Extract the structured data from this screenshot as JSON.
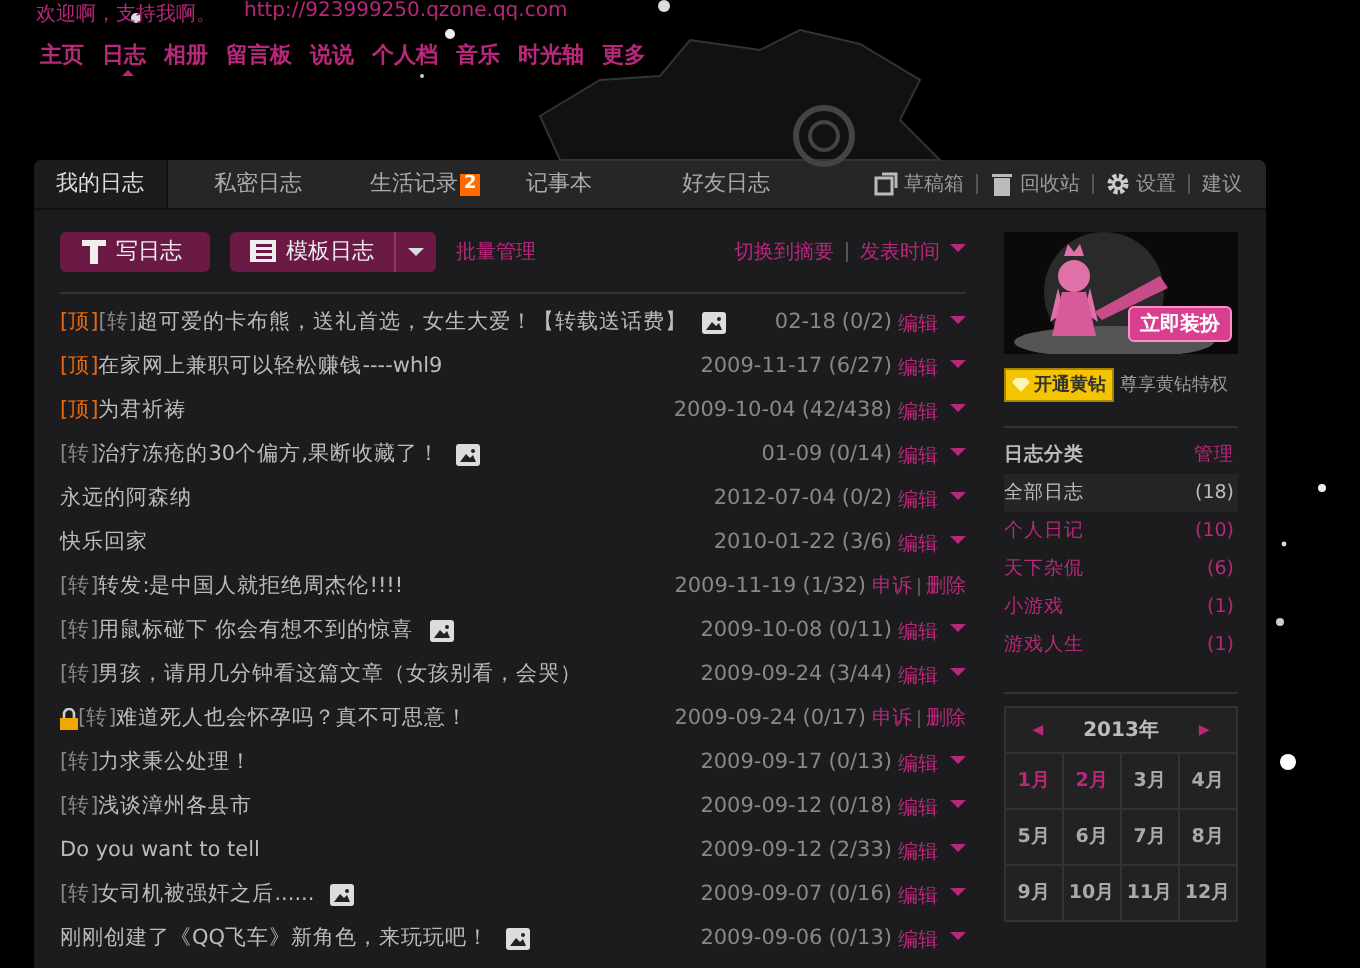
{
  "header": {
    "greeting": "欢迎啊，支持我啊。",
    "url": "http://923999250.qzone.qq.com",
    "nav": [
      {
        "label": "主页",
        "selected": false
      },
      {
        "label": "日志",
        "selected": true
      },
      {
        "label": "相册",
        "selected": false
      },
      {
        "label": "留言板",
        "selected": false
      },
      {
        "label": "说说",
        "selected": false
      },
      {
        "label": "个人档",
        "selected": false
      },
      {
        "label": "音乐",
        "selected": false
      },
      {
        "label": "时光轴",
        "selected": false
      },
      {
        "label": "更多",
        "selected": false
      }
    ]
  },
  "tabs": [
    {
      "label": "我的日志",
      "selected": true
    },
    {
      "label": "私密日志",
      "selected": false
    },
    {
      "label": "生活记录",
      "selected": false,
      "badge": "2"
    },
    {
      "label": "记事本",
      "selected": false
    },
    {
      "label": "好友日志",
      "selected": false
    }
  ],
  "tools": [
    {
      "kind": "drafts",
      "label": "草稿箱"
    },
    {
      "kind": "trash",
      "label": "回收站"
    },
    {
      "kind": "settings",
      "label": "设置"
    },
    {
      "kind": "plain",
      "label": "建议"
    }
  ],
  "toolbar": {
    "write_button": "写日志",
    "template_button": "模板日志",
    "batch": "批量管理",
    "switch": "切换到摘要",
    "sort": "发表时间"
  },
  "posts": [
    {
      "top": "[顶]",
      "tag": "[转]",
      "locked": false,
      "title": "超可爱的卡布熊，送礼首选，女生大爱！【转载送话费】",
      "image": true,
      "date": "02-18",
      "counts": "(0/2)",
      "actions": {
        "kind": "edit",
        "labels": [
          "编辑"
        ]
      }
    },
    {
      "top": "[顶]",
      "locked": false,
      "title": "在家网上兼职可以轻松赚钱----whl9",
      "image": false,
      "date": "2009-11-17",
      "counts": "(6/27)",
      "actions": {
        "kind": "edit",
        "labels": [
          "编辑"
        ]
      }
    },
    {
      "top": "[顶]",
      "locked": false,
      "title": "为君祈祷",
      "image": false,
      "date": "2009-10-04",
      "counts": "(42/438)",
      "actions": {
        "kind": "edit",
        "labels": [
          "编辑"
        ]
      }
    },
    {
      "tag": "[转]",
      "locked": false,
      "title": "治疗冻疮的30个偏方,果断收藏了！",
      "image": true,
      "date": "01-09",
      "counts": "(0/14)",
      "actions": {
        "kind": "edit",
        "labels": [
          "编辑"
        ]
      }
    },
    {
      "locked": false,
      "title": "永远的阿森纳",
      "image": false,
      "date": "2012-07-04",
      "counts": "(0/2)",
      "actions": {
        "kind": "edit",
        "labels": [
          "编辑"
        ]
      }
    },
    {
      "locked": false,
      "title": "快乐回家",
      "image": false,
      "date": "2010-01-22",
      "counts": "(3/6)",
      "actions": {
        "kind": "edit",
        "labels": [
          "编辑"
        ]
      }
    },
    {
      "tag": "[转]",
      "locked": false,
      "title": "转发:是中国人就拒绝周杰伦!!!!",
      "image": false,
      "date": "2009-11-19",
      "counts": "(1/32)",
      "actions": {
        "kind": "report",
        "labels": [
          "申诉",
          "删除"
        ]
      }
    },
    {
      "tag": "[转]",
      "locked": false,
      "title": "用鼠标碰下 你会有想不到的惊喜",
      "image": true,
      "date": "2009-10-08",
      "counts": "(0/11)",
      "actions": {
        "kind": "edit",
        "labels": [
          "编辑"
        ]
      }
    },
    {
      "tag": "[转]",
      "locked": false,
      "title": "男孩，请用几分钟看这篇文章（女孩别看，会哭）",
      "image": false,
      "date": "2009-09-24",
      "counts": "(3/44)",
      "actions": {
        "kind": "edit",
        "labels": [
          "编辑"
        ]
      }
    },
    {
      "tag": "[转]",
      "locked": true,
      "title": "难道死人也会怀孕吗？真不可思意！",
      "image": false,
      "date": "2009-09-24",
      "counts": "(0/17)",
      "actions": {
        "kind": "report",
        "labels": [
          "申诉",
          "删除"
        ]
      }
    },
    {
      "tag": "[转]",
      "locked": false,
      "title": "力求秉公处理！",
      "image": false,
      "date": "2009-09-17",
      "counts": "(0/13)",
      "actions": {
        "kind": "edit",
        "labels": [
          "编辑"
        ]
      }
    },
    {
      "tag": "[转]",
      "locked": false,
      "title": "浅谈漳州各县市",
      "image": false,
      "date": "2009-09-12",
      "counts": "(0/18)",
      "actions": {
        "kind": "edit",
        "labels": [
          "编辑"
        ]
      }
    },
    {
      "locked": false,
      "title": "Do you want to tell",
      "image": false,
      "date": "2009-09-12",
      "counts": "(2/33)",
      "actions": {
        "kind": "edit",
        "labels": [
          "编辑"
        ]
      }
    },
    {
      "tag": "[转]",
      "locked": false,
      "title": "女司机被强奸之后......",
      "image": true,
      "date": "2009-09-07",
      "counts": "(0/16)",
      "actions": {
        "kind": "edit",
        "labels": [
          "编辑"
        ]
      }
    },
    {
      "locked": false,
      "title": "刚刚创建了《QQ飞车》新角色，来玩玩吧！",
      "image": true,
      "date": "2009-09-06",
      "counts": "(0/13)",
      "actions": {
        "kind": "edit",
        "labels": [
          "编辑"
        ]
      }
    }
  ],
  "sidebar": {
    "banner_button": "立即装扮",
    "vip_button": "开通黄钻",
    "vip_text": "尊享黄钻特权",
    "categories_title": "日志分类",
    "manage": "管理",
    "categories": [
      {
        "name": "全部日志",
        "count": "(18)",
        "selected": true
      },
      {
        "name": "个人日记",
        "count": "(10)",
        "selected": false
      },
      {
        "name": "天下杂侃",
        "count": "(6)",
        "selected": false
      },
      {
        "name": "小游戏",
        "count": "(1)",
        "selected": false
      },
      {
        "name": "游戏人生",
        "count": "(1)",
        "selected": false
      }
    ],
    "calendar": {
      "year": "2013年",
      "prev": "◀",
      "next": "▶",
      "months": [
        {
          "label": "1月",
          "has_posts": true
        },
        {
          "label": "2月",
          "has_posts": true
        },
        {
          "label": "3月",
          "has_posts": false
        },
        {
          "label": "4月",
          "has_posts": false
        },
        {
          "label": "5月",
          "has_posts": false
        },
        {
          "label": "6月",
          "has_posts": false
        },
        {
          "label": "7月",
          "has_posts": false
        },
        {
          "label": "8月",
          "has_posts": false
        },
        {
          "label": "9月",
          "has_posts": false
        },
        {
          "label": "10月",
          "has_posts": false
        },
        {
          "label": "11月",
          "has_posts": false
        },
        {
          "label": "12月",
          "has_posts": false
        }
      ]
    }
  }
}
